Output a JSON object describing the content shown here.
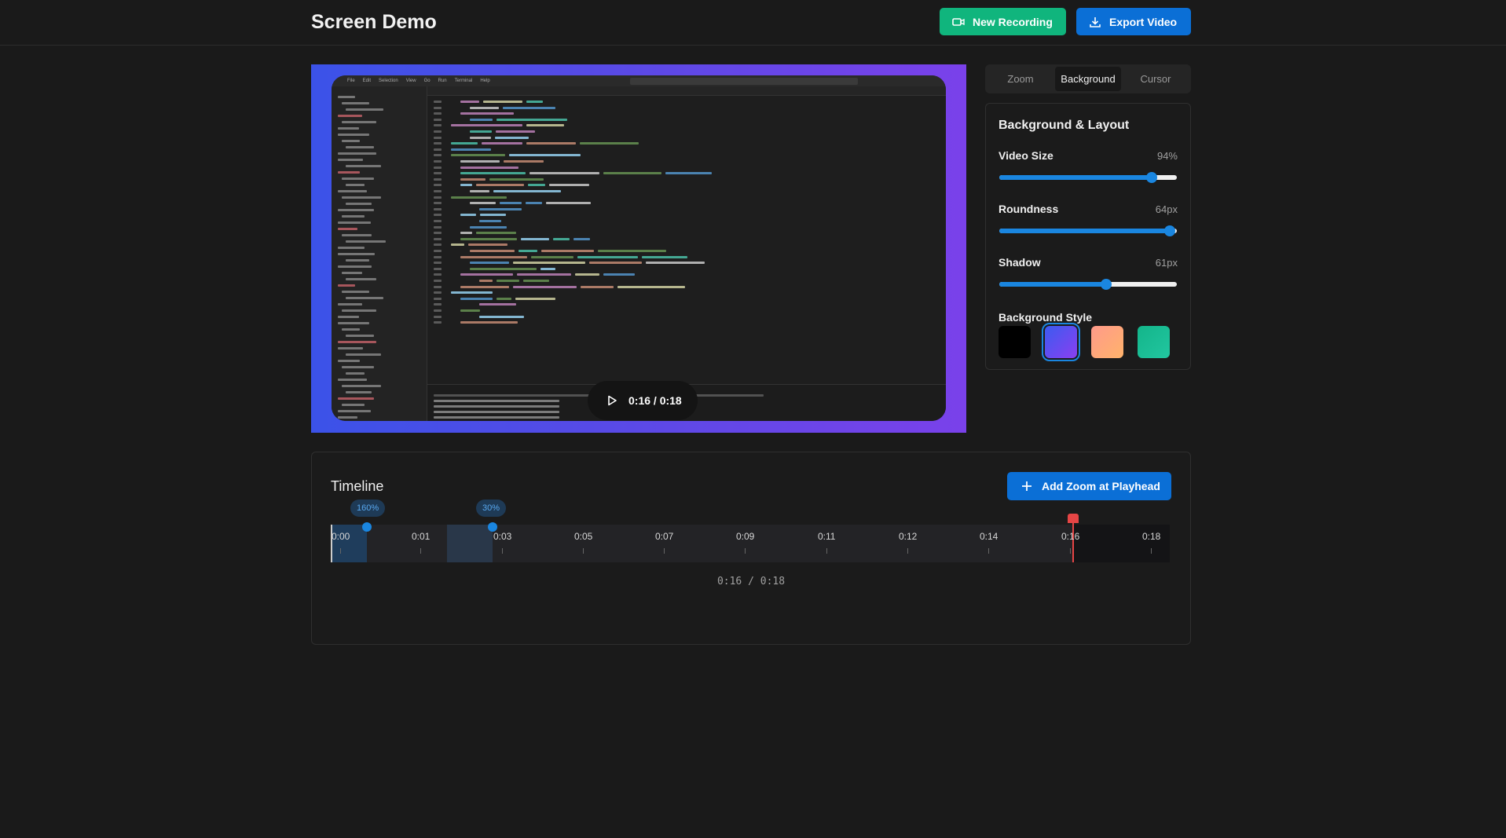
{
  "header": {
    "title": "Screen Demo",
    "new_recording_label": "New Recording",
    "export_label": "Export Video"
  },
  "preview": {
    "time": "0:16 / 0:18",
    "editor": {
      "menu": [
        "File",
        "Edit",
        "Selection",
        "View",
        "Go",
        "Run",
        "Terminal",
        "Help"
      ]
    }
  },
  "tabs": [
    {
      "label": "Zoom",
      "active": false
    },
    {
      "label": "Background",
      "active": true
    },
    {
      "label": "Cursor",
      "active": false
    }
  ],
  "panel": {
    "title": "Background & Layout",
    "sliders": [
      {
        "label": "Video Size",
        "value_text": "94%",
        "fraction": 0.86
      },
      {
        "label": "Roundness",
        "value_text": "64px",
        "fraction": 0.96
      },
      {
        "label": "Shadow",
        "value_text": "61px",
        "fraction": 0.6
      }
    ],
    "style_label": "Background Style",
    "swatches": [
      {
        "name": "black",
        "color": "#000000",
        "selected": false
      },
      {
        "name": "blue-purple",
        "color": "linear-gradient(135deg,#3b5bf0,#8a3ff0)",
        "selected": true
      },
      {
        "name": "peach",
        "color": "linear-gradient(135deg,#ff9a8a,#ffb36b)",
        "selected": false
      },
      {
        "name": "teal",
        "color": "linear-gradient(135deg,#13b58a,#22c6a0)",
        "selected": false
      }
    ]
  },
  "timeline": {
    "title": "Timeline",
    "add_zoom_label": "Add Zoom at Playhead",
    "ticks": [
      "0:00",
      "0:01",
      "0:03",
      "0:05",
      "0:07",
      "0:09",
      "0:11",
      "0:12",
      "0:14",
      "0:16",
      "0:18"
    ],
    "zooms": [
      {
        "label": "160%"
      },
      {
        "label": "30%"
      }
    ],
    "time": "0:16 / 0:18",
    "colors": {
      "accent": "#1a86e0",
      "playhead": "#e64545"
    }
  }
}
